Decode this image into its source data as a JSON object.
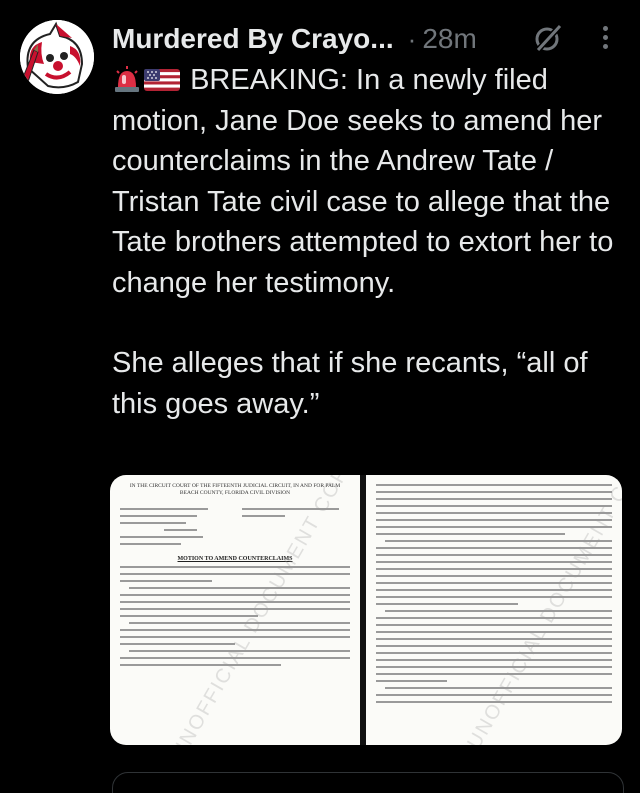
{
  "author": {
    "display_name": "Murdered By Crayo...",
    "separator": "·",
    "time_ago": "28m"
  },
  "icons": {
    "avatar": "clown-avatar-icon",
    "grok": "grok-icon",
    "more": "more-options-icon",
    "siren": "police-siren-emoji",
    "flag": "us-flag-emoji"
  },
  "tweet": {
    "paragraph1": "BREAKING: In a newly filed motion, Jane Doe seeks to amend her counterclaims in the Andrew Tate / Tristan Tate civil case to allege that the Tate brothers attempted to extort her to change her testimony.",
    "paragraph2": "She alleges that if she recants, “all of this goes away.”"
  },
  "media": {
    "left_doc": {
      "court_caption": "IN THE CIRCUIT COURT OF THE FIFTEENTH JUDICIAL CIRCUIT, IN AND FOR PALM BEACH COUNTY, FLORIDA CIVIL DIVISION",
      "title": "MOTION TO AMEND COUNTERCLAIMS",
      "watermark": "UNOFFICIAL DOCUMENT COPY"
    },
    "right_doc": {
      "watermark": "UNOFFICIAL DOCUMENT COPY"
    }
  },
  "colors": {
    "background": "#000000",
    "text_primary": "#e7e9ea",
    "text_secondary": "#71767b",
    "border": "#2f3336"
  }
}
